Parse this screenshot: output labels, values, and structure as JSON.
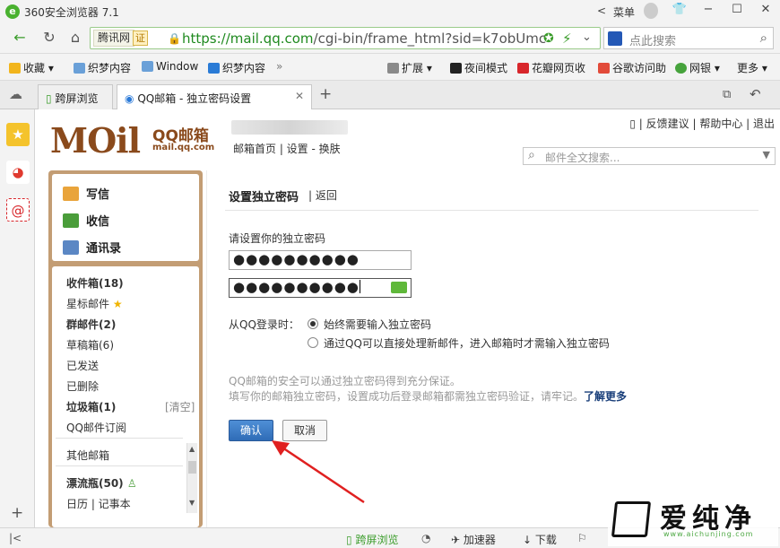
{
  "window": {
    "title": "360安全浏览器 7.1",
    "menu_label": "菜单"
  },
  "address": {
    "site_tag": "腾讯网",
    "cert_tag": "证",
    "url_host": "https://mail.qq.com",
    "url_path": "/cgi-bin/frame_html?sid=k7obUmc",
    "search_placeholder": "点此搜索"
  },
  "bookmarks": {
    "left": [
      "收藏",
      "织梦内容",
      "Window",
      "织梦内容"
    ],
    "more_arrows": "»",
    "right": [
      "扩展",
      "夜间模式",
      "花瓣网页收",
      "谷歌访问助",
      "网银",
      "更多"
    ]
  },
  "tabs": [
    {
      "label": "跨屏浏览"
    },
    {
      "label": "QQ邮箱 - 独立密码设置"
    }
  ],
  "mail": {
    "logo_text": "MOil",
    "logo_cn": "QQ邮箱",
    "logo_domain": "mail.qq.com",
    "header_links": "邮箱首页 | 设置 - 换肤",
    "top_links": "| 反馈建议 | 帮助中心 | 退出",
    "search_placeholder": "邮件全文搜索...",
    "actions": [
      "写信",
      "收信",
      "通讯录"
    ],
    "folders": {
      "inbox": "收件箱(18)",
      "starred": "星标邮件",
      "group": "群邮件(2)",
      "drafts": "草稿箱(6)",
      "sent": "已发送",
      "deleted": "已删除",
      "junk": "垃圾箱(1)",
      "junk_clear": "[清空]",
      "subscription": "QQ邮件订阅",
      "other": "其他邮箱",
      "bottle": "漂流瓶(50)",
      "calendar_notes": "日历 | 记事本"
    }
  },
  "form": {
    "title": "设置独立密码",
    "back": "| 返回",
    "prompt": "请设置你的独立密码",
    "password1": "●●●●●●●●●●",
    "password2": "●●●●●●●●●●",
    "login_label": "从QQ登录时：",
    "option1": "始终需要输入独立密码",
    "option2": "通过QQ可以直接处理新邮件，进入邮箱时才需输入独立密码",
    "note1": "QQ邮箱的安全可以通过独立密码得到充分保证。",
    "note2": "填写你的邮箱独立密码，设置成功后登录邮箱都需独立密码验证，请牢记。",
    "learn_more": "了解更多",
    "ok": "确认",
    "cancel": "取消"
  },
  "status": {
    "cross_screen": "跨屏浏览",
    "accelerator": "加速器",
    "download": "下载"
  },
  "watermark": {
    "cn": "爱纯净",
    "en": "www.aichunjing.com"
  },
  "colors": {
    "accent_green": "#3a9c2a",
    "mail_brown": "#8a4a1c",
    "panel_tan": "#c39d74",
    "button_blue": "#2f6cb7"
  }
}
